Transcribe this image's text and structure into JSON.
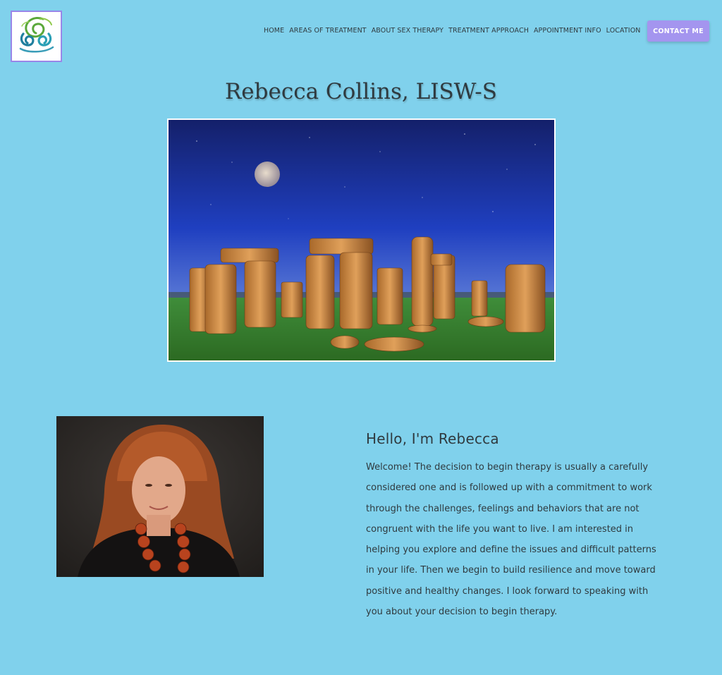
{
  "nav": {
    "items": [
      {
        "label": "HOME"
      },
      {
        "label": "AREAS OF TREATMENT"
      },
      {
        "label": "ABOUT SEX THERAPY"
      },
      {
        "label": "TREATMENT APPROACH"
      },
      {
        "label": "APPOINTMENT INFO"
      },
      {
        "label": "LOCATION"
      }
    ],
    "contact_label": "CONTACT ME"
  },
  "page": {
    "title": "Rebecca Collins, LISW-S"
  },
  "intro": {
    "heading": "Hello, I'm Rebecca",
    "body": "Welcome! The decision to begin therapy is usually a carefully considered one and is followed up with a commitment to work through the challenges, feelings and behaviors that are not congruent with the life you want to live. I am interested in helping you explore and define the issues and difficult patterns in your life. Then we begin to build resilience and move toward positive and healthy changes. I look forward to speaking with you about your decision to begin therapy."
  },
  "colors": {
    "background": "#80d1ec",
    "accent": "#a495ef",
    "text": "#2f3a3f"
  },
  "icons": {
    "logo": "triple-spiral-logo"
  }
}
